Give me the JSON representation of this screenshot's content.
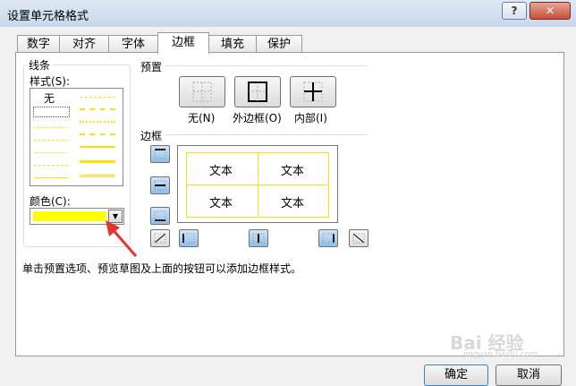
{
  "window": {
    "title": "设置单元格格式",
    "help_label": "?",
    "close_label": "✕"
  },
  "tabs": [
    {
      "label": "数字"
    },
    {
      "label": "对齐"
    },
    {
      "label": "字体"
    },
    {
      "label": "边框",
      "selected": true
    },
    {
      "label": "填充"
    },
    {
      "label": "保护"
    }
  ],
  "line_group": {
    "title": "线条",
    "style_label": "样式(S):",
    "style_none": "无",
    "color_label": "颜色(C):",
    "color_value": "#ffff00"
  },
  "presets": {
    "title": "预置",
    "items": [
      {
        "label": "无(N)"
      },
      {
        "label": "外边框(O)"
      },
      {
        "label": "内部(I)"
      }
    ]
  },
  "border": {
    "title": "边框",
    "preview_cells": [
      "文本",
      "文本",
      "文本",
      "文本"
    ],
    "buttons": [
      "top-border",
      "inside-horizontal-border",
      "bottom-border",
      "diagonal-up-border",
      "left-border",
      "inside-vertical-border",
      "right-border",
      "diagonal-down-border"
    ]
  },
  "hint": "单击预置选项、预览草图及上面的按钮可以添加边框样式。",
  "footer": {
    "ok_label": "确定",
    "cancel_label": "取消"
  },
  "watermark": {
    "text": "Bai 经验",
    "sub": "jingyan.baidu.com"
  },
  "colors": {
    "accent_yellow": "#ffff00",
    "arrow_red": "#e8322d"
  }
}
